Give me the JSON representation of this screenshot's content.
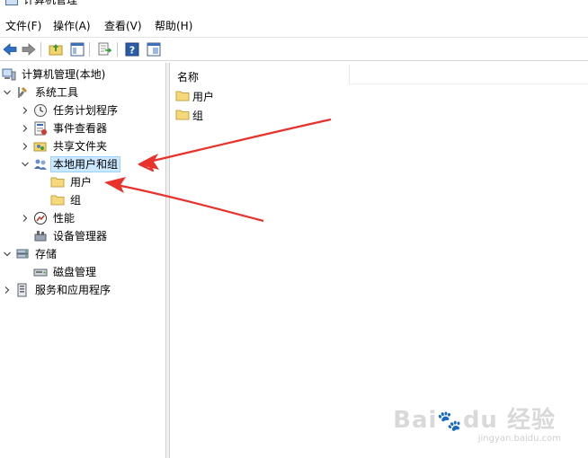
{
  "window": {
    "title": "计算机管理"
  },
  "menu": [
    "文件(F)",
    "操作(A)",
    "查看(V)",
    "帮助(H)"
  ],
  "toolbar": {
    "icons": [
      "back-arrow-icon",
      "forward-arrow-icon",
      "up-folder-icon",
      "show-hide-tree-icon",
      "export-list-icon",
      "help-icon",
      "properties-icon"
    ]
  },
  "tree": {
    "root": "计算机管理(本地)",
    "system_tools": "系统工具",
    "task_scheduler": "任务计划程序",
    "event_viewer": "事件查看器",
    "shared_folders": "共享文件夹",
    "local_users_groups": "本地用户和组",
    "users": "用户",
    "groups": "组",
    "performance": "性能",
    "device_manager": "设备管理器",
    "storage": "存储",
    "disk_management": "磁盘管理",
    "services_apps": "服务和应用程序"
  },
  "list": {
    "column_name": "名称",
    "items": [
      "用户",
      "组"
    ]
  },
  "colors": {
    "selection": "#cce8ff",
    "selection_border": "#99d1ff",
    "arrow": "#e8322b",
    "folder": "#f5d87a"
  }
}
